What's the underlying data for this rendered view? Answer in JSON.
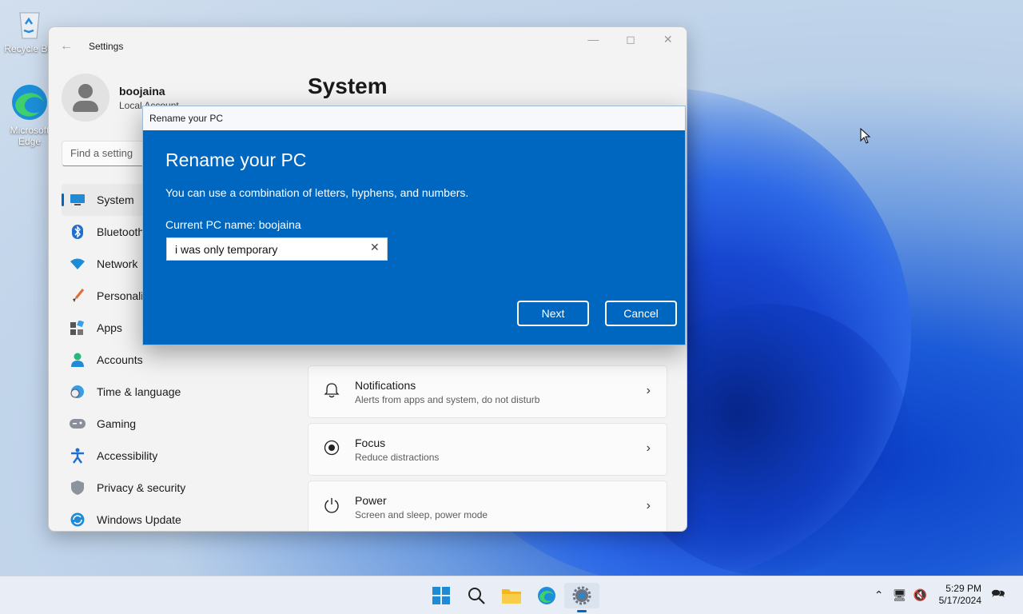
{
  "desktop": {
    "icons": [
      {
        "label": "Recycle Bin",
        "icon": "recycle-bin-icon"
      },
      {
        "label": "Microsoft Edge",
        "icon": "edge-icon"
      }
    ]
  },
  "window": {
    "title": "Settings",
    "controls": [
      "minimize",
      "maximize",
      "close"
    ]
  },
  "profile": {
    "name": "boojaina",
    "type": "Local Account"
  },
  "search": {
    "placeholder": "Find a setting"
  },
  "nav": {
    "items": [
      {
        "label": "System",
        "icon": "monitor-icon",
        "active": true
      },
      {
        "label": "Bluetooth",
        "icon": "bluetooth-icon"
      },
      {
        "label": "Network",
        "icon": "wifi-icon"
      },
      {
        "label": "Personaliz",
        "icon": "brush-icon"
      },
      {
        "label": "Apps",
        "icon": "apps-icon"
      },
      {
        "label": "Accounts",
        "icon": "person-icon"
      },
      {
        "label": "Time & language",
        "icon": "globe-clock-icon"
      },
      {
        "label": "Gaming",
        "icon": "gamepad-icon"
      },
      {
        "label": "Accessibility",
        "icon": "accessibility-icon"
      },
      {
        "label": "Privacy & security",
        "icon": "shield-icon"
      },
      {
        "label": "Windows Update",
        "icon": "update-icon"
      }
    ]
  },
  "main": {
    "title": "System",
    "cards": [
      {
        "title": "Notifications",
        "subtitle": "Alerts from apps and system, do not disturb",
        "icon": "bell-icon"
      },
      {
        "title": "Focus",
        "subtitle": "Reduce distractions",
        "icon": "focus-icon"
      },
      {
        "title": "Power",
        "subtitle": "Screen and sleep, power mode",
        "icon": "power-icon"
      }
    ]
  },
  "dialog": {
    "window_title": "Rename your PC",
    "heading": "Rename your PC",
    "description": "You can use a combination of letters, hyphens, and numbers.",
    "current_name": "Current PC name: boojaina",
    "input_value": "i was only temporary",
    "next_label": "Next",
    "cancel_label": "Cancel"
  },
  "taskbar": {
    "apps": [
      "start-icon",
      "search-icon",
      "file-explorer-icon",
      "edge-icon",
      "settings-icon"
    ],
    "time": "5:29 PM",
    "date": "5/17/2024"
  },
  "colors": {
    "accent": "#0067c0"
  }
}
